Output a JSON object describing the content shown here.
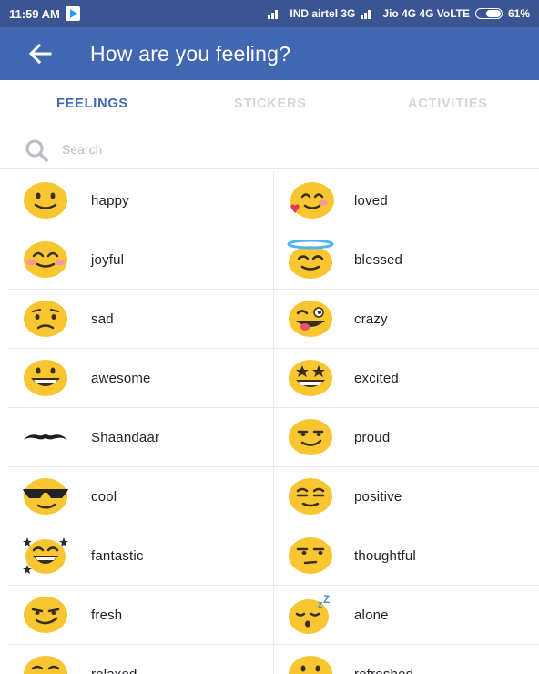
{
  "status_bar": {
    "time": "11:59 AM",
    "network_left": "IND airtel 3G",
    "network_right": "Jio 4G 4G VoLTE",
    "battery": "61%"
  },
  "header": {
    "title": "How are you feeling?"
  },
  "tabs": [
    {
      "label": "FEELINGS",
      "active": true
    },
    {
      "label": "STICKERS",
      "active": false
    },
    {
      "label": "ACTIVITIES",
      "active": false
    }
  ],
  "search": {
    "placeholder": "Search",
    "value": ""
  },
  "feelings": [
    {
      "label": "happy",
      "icon": "happy-face-icon"
    },
    {
      "label": "loved",
      "icon": "loved-face-icon"
    },
    {
      "label": "joyful",
      "icon": "joyful-face-icon"
    },
    {
      "label": "blessed",
      "icon": "blessed-face-icon"
    },
    {
      "label": "sad",
      "icon": "sad-face-icon"
    },
    {
      "label": "crazy",
      "icon": "crazy-face-icon"
    },
    {
      "label": "awesome",
      "icon": "awesome-face-icon"
    },
    {
      "label": "excited",
      "icon": "excited-face-icon"
    },
    {
      "label": "Shaandaar",
      "icon": "mustache-icon"
    },
    {
      "label": "proud",
      "icon": "proud-face-icon"
    },
    {
      "label": "cool",
      "icon": "cool-face-icon"
    },
    {
      "label": "positive",
      "icon": "positive-face-icon"
    },
    {
      "label": "fantastic",
      "icon": "fantastic-face-icon"
    },
    {
      "label": "thoughtful",
      "icon": "thoughtful-face-icon"
    },
    {
      "label": "fresh",
      "icon": "fresh-face-icon"
    },
    {
      "label": "alone",
      "icon": "alone-face-icon"
    },
    {
      "label": "relaxed",
      "icon": "relaxed-face-icon"
    },
    {
      "label": "refreshed",
      "icon": "refreshed-face-icon"
    }
  ],
  "colors": {
    "brand_blue": "#4267b2",
    "status_bar": "#3b5592",
    "emoji_yellow": "#f7c631",
    "inactive_tab": "#d4d6db"
  }
}
